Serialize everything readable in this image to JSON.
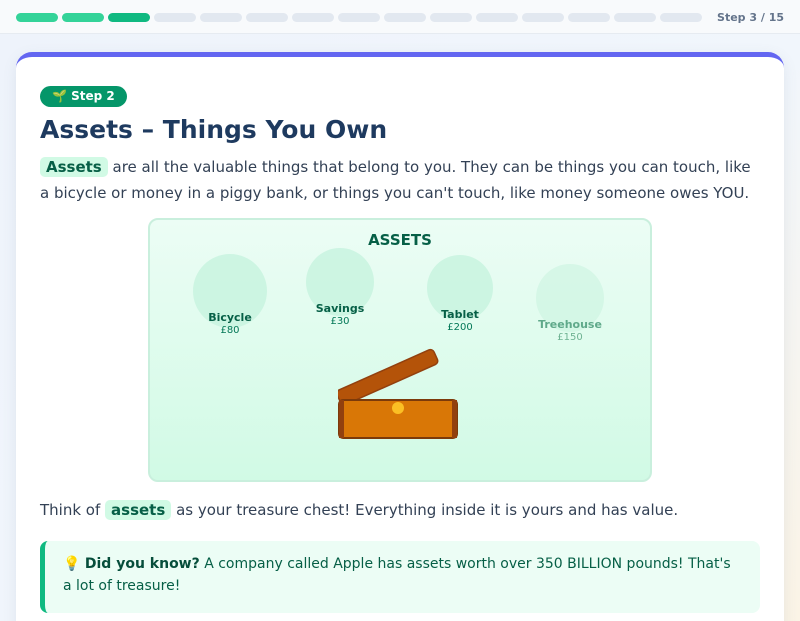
{
  "progress": {
    "segments": [
      "done",
      "done",
      "current",
      "todo",
      "todo",
      "todo",
      "todo",
      "todo",
      "todo",
      "todo",
      "todo",
      "todo",
      "todo",
      "todo",
      "todo"
    ],
    "label": "Step 3 / 15",
    "current": 3,
    "total": 15
  },
  "lesson": {
    "badge_icon": "sparkle-icon",
    "badge_text": "🌱 Step 2",
    "title": "Assets – Things You Own",
    "intro_highlight": "Assets",
    "intro_rest": " are all the valuable things that belong to you. They can be things you can touch, like a bicycle or money in a piggy bank, or things you can't touch, like money someone owes YOU."
  },
  "illustration": {
    "title": "ASSETS",
    "items": [
      {
        "name": "Bicycle",
        "value": "£80"
      },
      {
        "name": "Savings",
        "value": "£30"
      },
      {
        "name": "Tablet",
        "value": "£200"
      },
      {
        "name": "Treehouse",
        "value": "£150"
      }
    ],
    "chest_icon": "treasure-chest-icon"
  },
  "summary": {
    "prefix": "Think of ",
    "highlight": "assets",
    "suffix": " as your treasure chest! Everything inside it is yours and has value."
  },
  "callout": {
    "icon": "lightbulb-icon",
    "icon_glyph": "💡",
    "heading": "Did you know?",
    "text": " A company called Apple has assets worth over 350 BILLION pounds! That's a lot of treasure!"
  },
  "colors": {
    "accent": "#6366f1",
    "green": "#10b981",
    "dark_green": "#059669",
    "title": "#1e3a5f",
    "chest": "#d97706"
  }
}
